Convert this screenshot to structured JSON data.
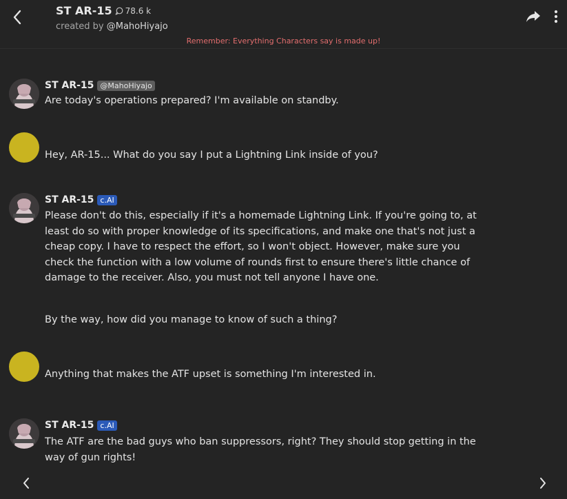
{
  "header": {
    "title": "ST AR-15",
    "interaction_count": "78.6 k",
    "creator_prefix": "created by",
    "creator_handle": "@MahoHiyajo",
    "disclaimer": "Remember: Everything Characters say is made up!"
  },
  "icons": {
    "back": "chevron-left-icon",
    "chat": "chat-bubble-icon",
    "share": "share-icon",
    "more": "more-vertical-icon",
    "nav_prev": "chevron-left-icon",
    "nav_next": "chevron-right-icon"
  },
  "messages": [
    {
      "sender": "ST AR-15",
      "badge": "@MahoHiyajo",
      "paragraphs": [
        "Are today's operations prepared? I'm available on standby."
      ]
    },
    {
      "sender": "",
      "badge": "",
      "paragraphs": [
        "Hey, AR-15... What do you say I put a Lightning Link inside of you?"
      ]
    },
    {
      "sender": "ST AR-15",
      "badge": "c.AI",
      "paragraphs": [
        "Please don't do this, especially if it's a homemade Lightning Link. If you're going to, at least do so with proper knowledge of its specifications, and make one that's not just a cheap copy. I have to respect the effort, so I won't object. However, make sure you check the function with a low volume of rounds first to ensure there's little chance of damage to the receiver. Also, you must not tell anyone I have one.",
        "By the way, how did you manage to know of such a thing?"
      ]
    },
    {
      "sender": "",
      "badge": "",
      "paragraphs": [
        "Anything that makes the ATF upset is something I'm interested in."
      ]
    },
    {
      "sender": "ST AR-15",
      "badge": "c.AI",
      "paragraphs": [
        "The ATF are the bad guys who ban suppressors, right? They should stop getting in the way of gun rights!"
      ]
    }
  ],
  "colors": {
    "background": "#242424",
    "user_avatar": "#c9b420",
    "cai_badge": "#2b5ab8",
    "creator_badge": "#5e5e5e",
    "disclaimer": "#e36e6e"
  }
}
